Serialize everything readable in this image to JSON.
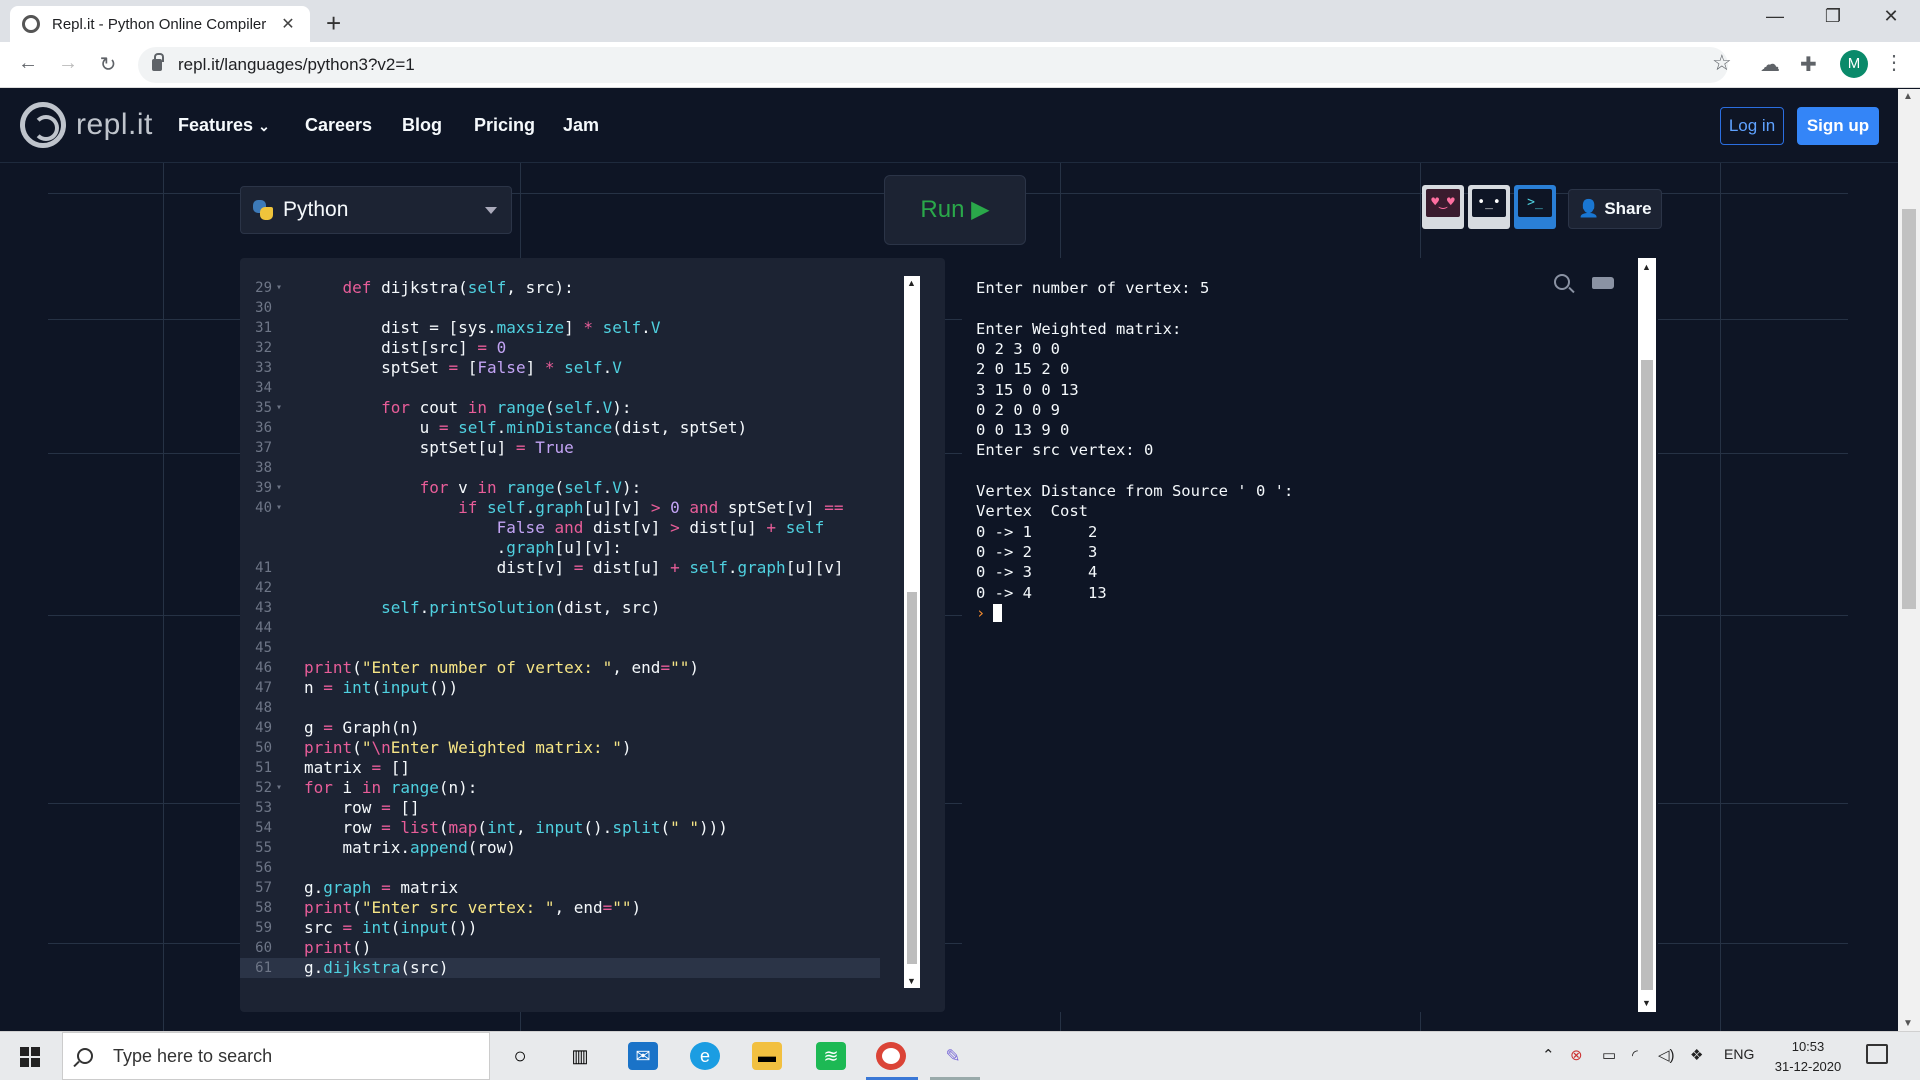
{
  "browser": {
    "tab_title": "Repl.it - Python Online Compiler",
    "tab_close": "✕",
    "new_tab": "+",
    "url": "repl.it/languages/python3?v2=1",
    "profile_initial": "M",
    "window_controls": [
      "—",
      "❐",
      "✕"
    ]
  },
  "site": {
    "logo_text": "repl.it",
    "nav": [
      "Features",
      "Careers",
      "Blog",
      "Pricing",
      "Jam"
    ],
    "features_caret": "⌄",
    "login": "Log in",
    "signup": "Sign up"
  },
  "toolbar": {
    "language": "Python",
    "run": "Run ▶",
    "share": "Share",
    "avatars": [
      "♥‿♥",
      "•_•",
      ">_"
    ]
  },
  "editor": {
    "lines": [
      {
        "n": "29",
        "fold": "▾",
        "html": "    <span class='k'>def</span> dijkstra(<span class='f'>self</span>, src):"
      },
      {
        "n": "30",
        "fold": "",
        "html": ""
      },
      {
        "n": "31",
        "fold": "",
        "html": "        dist = [sys.<span class='f'>maxsize</span>] <span class='k'>*</span> <span class='f'>self</span>.<span class='f'>V</span>"
      },
      {
        "n": "32",
        "fold": "",
        "html": "        dist[src] <span class='k'>=</span> <span class='n'>0</span>"
      },
      {
        "n": "33",
        "fold": "",
        "html": "        sptSet <span class='k'>=</span> [<span class='n'>False</span>] <span class='k'>*</span> <span class='f'>self</span>.<span class='f'>V</span>"
      },
      {
        "n": "34",
        "fold": "",
        "html": ""
      },
      {
        "n": "35",
        "fold": "▾",
        "html": "        <span class='k'>for</span> cout <span class='k'>in</span> <span class='f'>range</span>(<span class='f'>self</span>.<span class='f'>V</span>):"
      },
      {
        "n": "36",
        "fold": "",
        "html": "            u <span class='k'>=</span> <span class='f'>self</span>.<span class='f'>minDistance</span>(dist, sptSet)"
      },
      {
        "n": "37",
        "fold": "",
        "html": "            sptSet[u] <span class='k'>=</span> <span class='n'>True</span>"
      },
      {
        "n": "38",
        "fold": "",
        "html": ""
      },
      {
        "n": "39",
        "fold": "▾",
        "html": "            <span class='k'>for</span> v <span class='k'>in</span> <span class='f'>range</span>(<span class='f'>self</span>.<span class='f'>V</span>):"
      },
      {
        "n": "40",
        "fold": "▾",
        "html": "                <span class='k'>if</span> <span class='f'>self</span>.<span class='f'>graph</span>[u][v] <span class='k'>&gt;</span> <span class='n'>0</span> <span class='k'>and</span> sptSet[v] <span class='k'>==</span>"
      },
      {
        "n": "",
        "fold": "",
        "html": "                    <span class='n'>False</span> <span class='k'>and</span> dist[v] <span class='k'>&gt;</span> dist[u] <span class='k'>+</span> <span class='f'>self</span>"
      },
      {
        "n": "",
        "fold": "",
        "html": "                    .<span class='f'>graph</span>[u][v]:"
      },
      {
        "n": "41",
        "fold": "",
        "html": "                    dist[v] <span class='k'>=</span> dist[u] <span class='k'>+</span> <span class='f'>self</span>.<span class='f'>graph</span>[u][v]"
      },
      {
        "n": "42",
        "fold": "",
        "html": ""
      },
      {
        "n": "43",
        "fold": "",
        "html": "        <span class='f'>self</span>.<span class='f'>printSolution</span>(dist, src)"
      },
      {
        "n": "44",
        "fold": "",
        "html": ""
      },
      {
        "n": "45",
        "fold": "",
        "html": ""
      },
      {
        "n": "46",
        "fold": "",
        "html": "<span class='k'>print</span>(<span class='s'>\"Enter number of vertex: \"</span>, end<span class='k'>=</span><span class='s'>\"\"</span>)"
      },
      {
        "n": "47",
        "fold": "",
        "html": "n <span class='k'>=</span> <span class='f'>int</span>(<span class='f'>input</span>())"
      },
      {
        "n": "48",
        "fold": "",
        "html": ""
      },
      {
        "n": "49",
        "fold": "",
        "html": "g <span class='k'>=</span> Graph(n)"
      },
      {
        "n": "50",
        "fold": "",
        "html": "<span class='k'>print</span>(<span class='s'>\"</span><span class='k'>\\n</span><span class='s'>Enter Weighted matrix: \"</span>)"
      },
      {
        "n": "51",
        "fold": "",
        "html": "matrix <span class='k'>=</span> []"
      },
      {
        "n": "52",
        "fold": "▾",
        "html": "<span class='k'>for</span> i <span class='k'>in</span> <span class='f'>range</span>(n):"
      },
      {
        "n": "53",
        "fold": "",
        "html": "    row <span class='k'>=</span> []"
      },
      {
        "n": "54",
        "fold": "",
        "html": "    row <span class='k'>=</span> <span class='k'>list</span>(<span class='k'>map</span>(<span class='f'>int</span>, <span class='f'>input</span>().<span class='f'>split</span>(<span class='s'>\" \"</span>)))"
      },
      {
        "n": "55",
        "fold": "",
        "html": "    matrix.<span class='f'>append</span>(row)"
      },
      {
        "n": "56",
        "fold": "",
        "html": ""
      },
      {
        "n": "57",
        "fold": "",
        "html": "g.<span class='f'>graph</span> <span class='k'>=</span> matrix"
      },
      {
        "n": "58",
        "fold": "",
        "html": "<span class='k'>print</span>(<span class='s'>\"Enter src vertex: \"</span>, end<span class='k'>=</span><span class='s'>\"\"</span>)"
      },
      {
        "n": "59",
        "fold": "",
        "html": "src <span class='k'>=</span> <span class='f'>int</span>(<span class='f'>input</span>())"
      },
      {
        "n": "60",
        "fold": "",
        "html": "<span class='k'>print</span>()"
      },
      {
        "n": "61",
        "fold": "",
        "html": "g.<span class='f'>dijkstra</span>(src)"
      }
    ]
  },
  "console": {
    "lines": [
      "Enter number of vertex: 5",
      "",
      "Enter Weighted matrix:",
      "0 2 3 0 0",
      "2 0 15 2 0",
      "3 15 0 0 13",
      "0 2 0 0 9",
      "0 0 13 9 0",
      "Enter src vertex: 0",
      "",
      "Vertex Distance from Source ' 0 ':",
      "Vertex  Cost",
      "0 -> 1      2",
      "0 -> 2      3",
      "0 -> 3      4",
      "0 -> 4      13"
    ],
    "prompt": "›"
  },
  "taskbar": {
    "search_placeholder": "Type here to search",
    "lang": "ENG",
    "time": "10:53",
    "date": "31-12-2020"
  }
}
